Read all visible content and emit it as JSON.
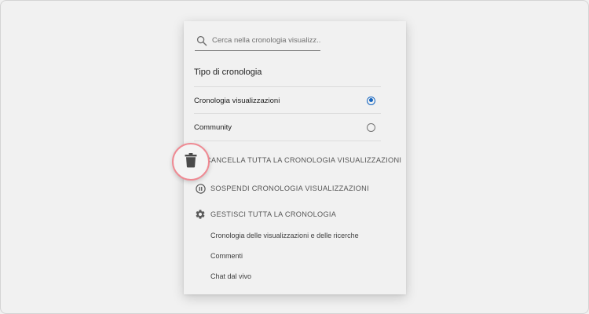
{
  "search": {
    "placeholder": "Cerca nella cronologia visualizz..."
  },
  "history_type": {
    "title": "Tipo di cronologia",
    "options": [
      {
        "label": "Cronologia visualizzazioni",
        "selected": true
      },
      {
        "label": "Community",
        "selected": false
      }
    ]
  },
  "actions": {
    "clear_label": "CANCELLA TUTTA LA CRONOLOGIA VISUALIZZAZIONI",
    "pause_label": "SOSPENDI CRONOLOGIA VISUALIZZAZIONI",
    "manage_label": "GESTISCI TUTTA LA CRONOLOGIA"
  },
  "manage_links": [
    "Cronologia delle visualizzazioni e delle ricerche",
    "Commenti",
    "Chat dal vivo"
  ],
  "colors": {
    "accent": "#1565c0",
    "highlight_ring": "#ef8a93",
    "icon": "#5a5a5a"
  },
  "icons": {
    "search": "search-icon",
    "trash": "trash-icon",
    "pause": "pause-circle-icon",
    "settings": "gear-icon"
  }
}
